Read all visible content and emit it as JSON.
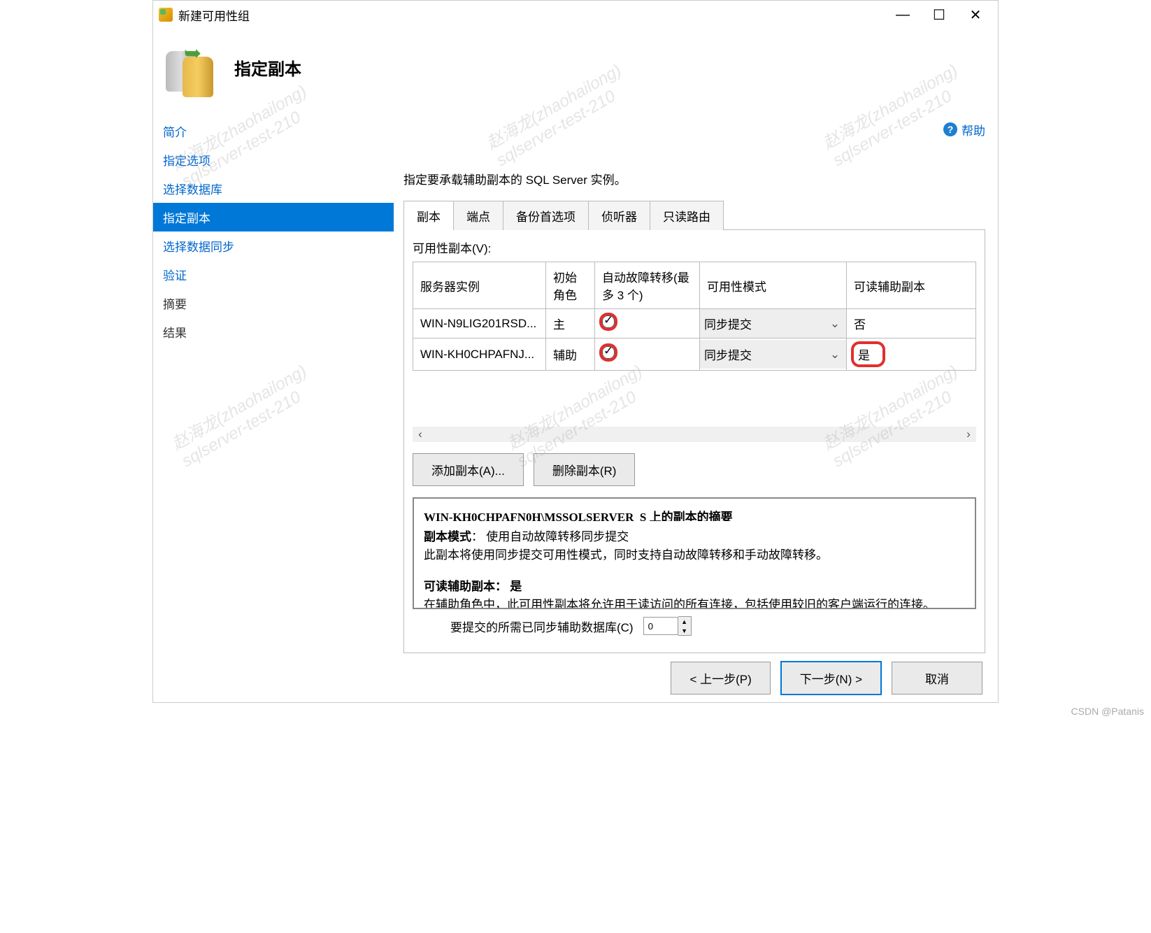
{
  "window": {
    "title": "新建可用性组"
  },
  "header": {
    "page_title": "指定副本"
  },
  "help": {
    "label": "帮助"
  },
  "sidebar": {
    "items": [
      {
        "label": "简介"
      },
      {
        "label": "指定选项"
      },
      {
        "label": "选择数据库"
      },
      {
        "label": "指定副本"
      },
      {
        "label": "选择数据同步"
      },
      {
        "label": "验证"
      },
      {
        "label": "摘要"
      },
      {
        "label": "结果"
      }
    ]
  },
  "main": {
    "instruction": "指定要承载辅助副本的 SQL Server 实例。",
    "tabs": [
      "副本",
      "端点",
      "备份首选项",
      "侦听器",
      "只读路由"
    ],
    "section_label": "可用性副本(V):",
    "columns": {
      "server": "服务器实例",
      "role": "初始角色",
      "auto_failover": "自动故障转移(最多 3 个)",
      "mode": "可用性模式",
      "readable": "可读辅助副本"
    },
    "rows": [
      {
        "server": "WIN-N9LIG201RSD...",
        "role": "主",
        "auto_failover": true,
        "mode": "同步提交",
        "readable": "否"
      },
      {
        "server": "WIN-KH0CHPAFNJ...",
        "role": "辅助",
        "auto_failover": true,
        "mode": "同步提交",
        "readable": "是"
      }
    ],
    "add_replica": "添加副本(A)...",
    "remove_replica": "删除副本(R)",
    "info": {
      "line0": "WIN-KH0CHPAFN0H\\MSSQLSERVER_S 上的副本的摘要",
      "mode_label": "副本模式",
      "mode_val": "：  使用自动故障转移同步提交",
      "mode_desc": "此副本将使用同步提交可用性模式，同时支持自动故障转移和手动故障转移。",
      "read_label": "可读辅助副本：  是",
      "read_desc": "在辅助角色中，此可用性副本将允许用于读访问的所有连接，包括使用较旧的客户端运行的连接。"
    },
    "commit": {
      "label": "要提交的所需已同步辅助数据库(C)",
      "value": "0"
    }
  },
  "footer": {
    "prev": "< 上一步(P)",
    "next": "下一步(N) >",
    "cancel": "取消"
  },
  "attribution": "CSDN @Patanis"
}
